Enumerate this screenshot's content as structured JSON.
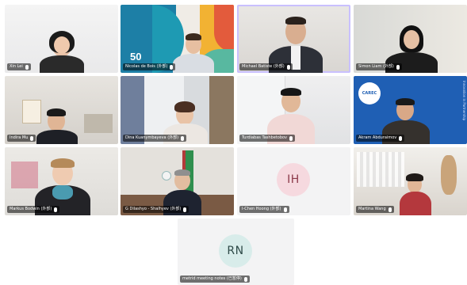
{
  "tiles": [
    {
      "name": "Xin Lei"
    },
    {
      "name": "Nicolas de Bois (外部)",
      "logo_text": "50"
    },
    {
      "name": "Michael Batiste (外部)"
    },
    {
      "name": "Simon Liam (外部)"
    },
    {
      "name": "Indira Mu"
    },
    {
      "name": "Dina Kuanymbayeva (外部)"
    },
    {
      "name": "Turdiabas Tashbetobov"
    },
    {
      "name": "Akram Abduraimov",
      "logo_text": "CAREC",
      "side_text": "Innovation in Partnership"
    },
    {
      "name": "Markus Bodwin (外部)"
    },
    {
      "name": "G Dilashyo - Shalhyev (外部)"
    },
    {
      "name": "I-Chen Hoong (外部)",
      "initials": "IH"
    },
    {
      "name": "Martina Wang"
    },
    {
      "name": "metrid meeting notes (已暂停)",
      "initials": "RN"
    }
  ],
  "colors": {
    "avatar_ih_bg": "#f6d9df",
    "avatar_ih_fg": "#8c3a4a",
    "avatar_rn_bg": "#d8ecea",
    "avatar_rn_fg": "#2e4a48",
    "active_border": "#c9c0ff"
  }
}
